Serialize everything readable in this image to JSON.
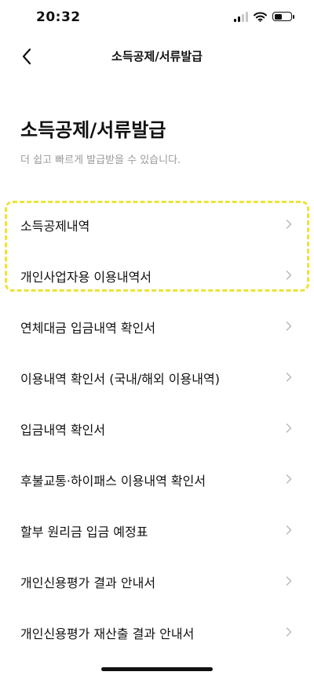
{
  "status": {
    "time": "20:32"
  },
  "nav": {
    "title": "소득공제/서류발급"
  },
  "page": {
    "title": "소득공제/서류발급",
    "subtitle": "더 쉽고 빠르게 발급받을 수 있습니다."
  },
  "menu": {
    "items": [
      {
        "label": "소득공제내역"
      },
      {
        "label": "개인사업자용 이용내역서"
      },
      {
        "label": "연체대금 입금내역 확인서"
      },
      {
        "label": "이용내역 확인서 (국내/해외 이용내역)"
      },
      {
        "label": "입금내역 확인서"
      },
      {
        "label": "후불교통·하이패스 이용내역 확인서"
      },
      {
        "label": "할부 원리금 입금 예정표"
      },
      {
        "label": "개인신용평가 결과 안내서"
      },
      {
        "label": "개인신용평가 재산출 결과 안내서"
      }
    ]
  },
  "icons": {
    "back": "chevron-left-icon",
    "item_arrow": "chevron-right-icon",
    "signal": "cellular-signal-icon",
    "wifi": "wifi-icon",
    "battery": "battery-icon"
  },
  "colors": {
    "highlight": "#ece33a",
    "subtitle": "#9a9a9a",
    "chevron": "#b5b5b5"
  }
}
